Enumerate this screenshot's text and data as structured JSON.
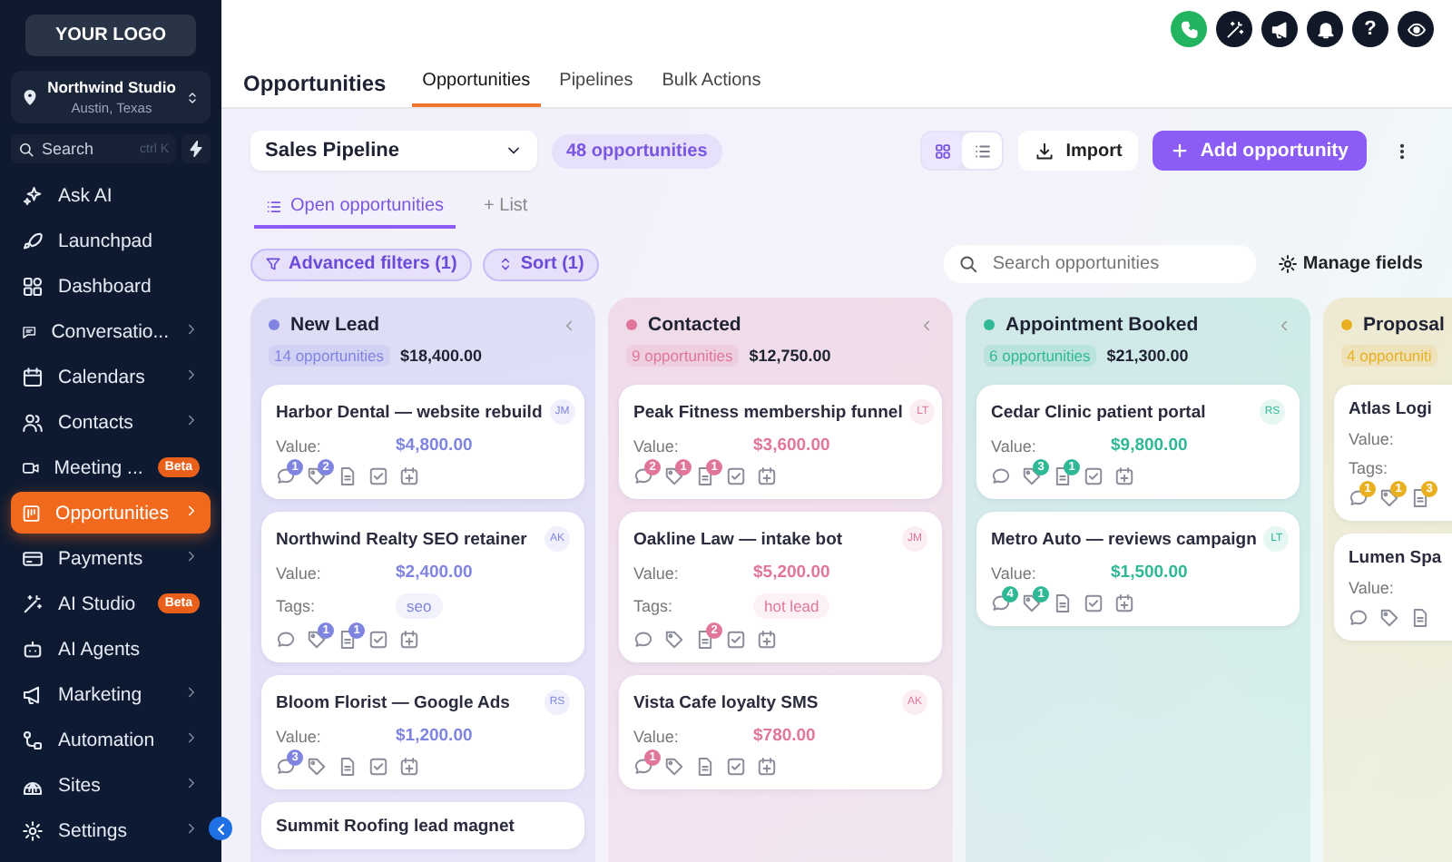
{
  "sidebar": {
    "logo": "YOUR LOGO",
    "location": {
      "name": "Northwind Studio",
      "city": "Austin, Texas"
    },
    "search": {
      "placeholder": "Search",
      "shortcut": "ctrl K"
    },
    "items": [
      {
        "label": "Ask AI",
        "submenu": false,
        "selected": false
      },
      {
        "label": "Launchpad",
        "submenu": false,
        "selected": false
      },
      {
        "label": "Dashboard",
        "submenu": false,
        "selected": false
      },
      {
        "label": "Conversatio...",
        "submenu": true,
        "selected": false
      },
      {
        "label": "Calendars",
        "submenu": true,
        "selected": false
      },
      {
        "label": "Contacts",
        "submenu": true,
        "selected": false
      },
      {
        "label": "Meeting ...",
        "submenu": false,
        "badge": "Beta",
        "selected": false
      },
      {
        "label": "Opportunities",
        "submenu": true,
        "selected": true
      },
      {
        "label": "Payments",
        "submenu": true,
        "selected": false
      },
      {
        "label": "AI Studio",
        "submenu": false,
        "badge": "Beta",
        "selected": false
      },
      {
        "label": "AI Agents",
        "submenu": false,
        "selected": false
      },
      {
        "label": "Marketing",
        "submenu": true,
        "selected": false
      },
      {
        "label": "Automation",
        "submenu": true,
        "selected": false
      },
      {
        "label": "Sites",
        "submenu": true,
        "selected": false
      },
      {
        "label": "Settings",
        "submenu": true,
        "selected": false
      }
    ]
  },
  "top_actions": [
    {
      "kind": "phone"
    },
    {
      "kind": "wand"
    },
    {
      "kind": "megaphone"
    },
    {
      "kind": "bell"
    },
    {
      "kind": "help",
      "label": "?"
    },
    {
      "kind": "eye"
    }
  ],
  "page_title": "Opportunities",
  "tabs": [
    {
      "label": "Opportunities",
      "selected": true
    },
    {
      "label": "Pipelines",
      "selected": false
    },
    {
      "label": "Bulk Actions",
      "selected": false
    }
  ],
  "toolbar": {
    "pipeline": "Sales Pipeline",
    "count": "48 opportunities",
    "views": [
      {
        "kind": "grid",
        "selected": true
      },
      {
        "kind": "list",
        "selected": false
      }
    ],
    "import": "Import",
    "add": "Add opportunity"
  },
  "subtabs": [
    {
      "label": "Open opportunities",
      "selected": true
    },
    {
      "label": "+ List",
      "selected": false
    }
  ],
  "filters": [
    {
      "kind": "filter",
      "label": "Advanced filters (1)"
    },
    {
      "kind": "sort",
      "label": "Sort (1)"
    }
  ],
  "search": {
    "placeholder": "Search opportunities"
  },
  "manage_fields": "Manage fields",
  "columns": [
    {
      "name": "New Lead",
      "color": "#7f84e0",
      "count": "14 opportunities",
      "total": "$18,400.00",
      "cards": [
        {
          "title": "Harbor Dental — website rebuild",
          "initials": "JM",
          "value_label": "Value:",
          "value": "$4,800.00",
          "actions": [
            {
              "kind": "chat",
              "count": "1"
            },
            {
              "kind": "tag",
              "count": "2"
            },
            {
              "kind": "note"
            },
            {
              "kind": "task"
            },
            {
              "kind": "event"
            }
          ]
        },
        {
          "title": "Northwind Realty SEO retainer",
          "initials": "AK",
          "value_label": "Value:",
          "value": "$2,400.00",
          "tags_label": "Tags:",
          "tag": "seo",
          "actions": [
            {
              "kind": "chat"
            },
            {
              "kind": "tag",
              "count": "1"
            },
            {
              "kind": "note",
              "count": "1"
            },
            {
              "kind": "task"
            },
            {
              "kind": "event"
            }
          ]
        },
        {
          "title": "Bloom Florist — Google Ads",
          "initials": "RS",
          "value_label": "Value:",
          "value": "$1,200.00",
          "actions": [
            {
              "kind": "chat",
              "count": "3"
            },
            {
              "kind": "tag"
            },
            {
              "kind": "note"
            },
            {
              "kind": "task"
            },
            {
              "kind": "event"
            }
          ]
        },
        {
          "title": "Summit Roofing lead magnet"
        }
      ]
    },
    {
      "name": "Contacted",
      "color": "#e0769a",
      "count": "9 opportunities",
      "total": "$12,750.00",
      "cards": [
        {
          "title": "Peak Fitness membership funnel",
          "initials": "LT",
          "value_label": "Value:",
          "value": "$3,600.00",
          "actions": [
            {
              "kind": "chat",
              "count": "2"
            },
            {
              "kind": "tag",
              "count": "1"
            },
            {
              "kind": "note",
              "count": "1"
            },
            {
              "kind": "task"
            },
            {
              "kind": "event"
            }
          ]
        },
        {
          "title": "Oakline Law — intake bot",
          "initials": "JM",
          "value_label": "Value:",
          "value": "$5,200.00",
          "tags_label": "Tags:",
          "tag": "hot lead",
          "actions": [
            {
              "kind": "chat"
            },
            {
              "kind": "tag"
            },
            {
              "kind": "note",
              "count": "2"
            },
            {
              "kind": "task"
            },
            {
              "kind": "event"
            }
          ]
        },
        {
          "title": "Vista Cafe loyalty SMS",
          "initials": "AK",
          "value_label": "Value:",
          "value": "$780.00",
          "actions": [
            {
              "kind": "chat",
              "count": "1"
            },
            {
              "kind": "tag"
            },
            {
              "kind": "note"
            },
            {
              "kind": "task"
            },
            {
              "kind": "event"
            }
          ]
        }
      ]
    },
    {
      "name": "Appointment Booked",
      "color": "#2fb896",
      "count": "6 opportunities",
      "total": "$21,300.00",
      "cards": [
        {
          "title": "Cedar Clinic patient portal",
          "initials": "RS",
          "value_label": "Value:",
          "value": "$9,800.00",
          "actions": [
            {
              "kind": "chat"
            },
            {
              "kind": "tag",
              "count": "3"
            },
            {
              "kind": "note",
              "count": "1"
            },
            {
              "kind": "task"
            },
            {
              "kind": "event"
            }
          ]
        },
        {
          "title": "Metro Auto — reviews campaign",
          "initials": "LT",
          "value_label": "Value:",
          "value": "$1,500.00",
          "actions": [
            {
              "kind": "chat",
              "count": "4"
            },
            {
              "kind": "tag",
              "count": "1"
            },
            {
              "kind": "note"
            },
            {
              "kind": "task"
            },
            {
              "kind": "event"
            }
          ]
        }
      ]
    },
    {
      "name": "Proposal",
      "color": "#e8b020",
      "count": "4 opportuniti",
      "cards": [
        {
          "title": "Atlas Logi",
          "value_label": "Value:",
          "tags_label": "Tags:",
          "actions": [
            {
              "kind": "chat",
              "count": "1"
            },
            {
              "kind": "tag",
              "count": "1"
            },
            {
              "kind": "note",
              "count": "3"
            }
          ]
        },
        {
          "title": "Lumen Spa",
          "value_label": "Value:",
          "actions": [
            {
              "kind": "chat"
            },
            {
              "kind": "tag"
            },
            {
              "kind": "note"
            }
          ]
        }
      ]
    }
  ]
}
